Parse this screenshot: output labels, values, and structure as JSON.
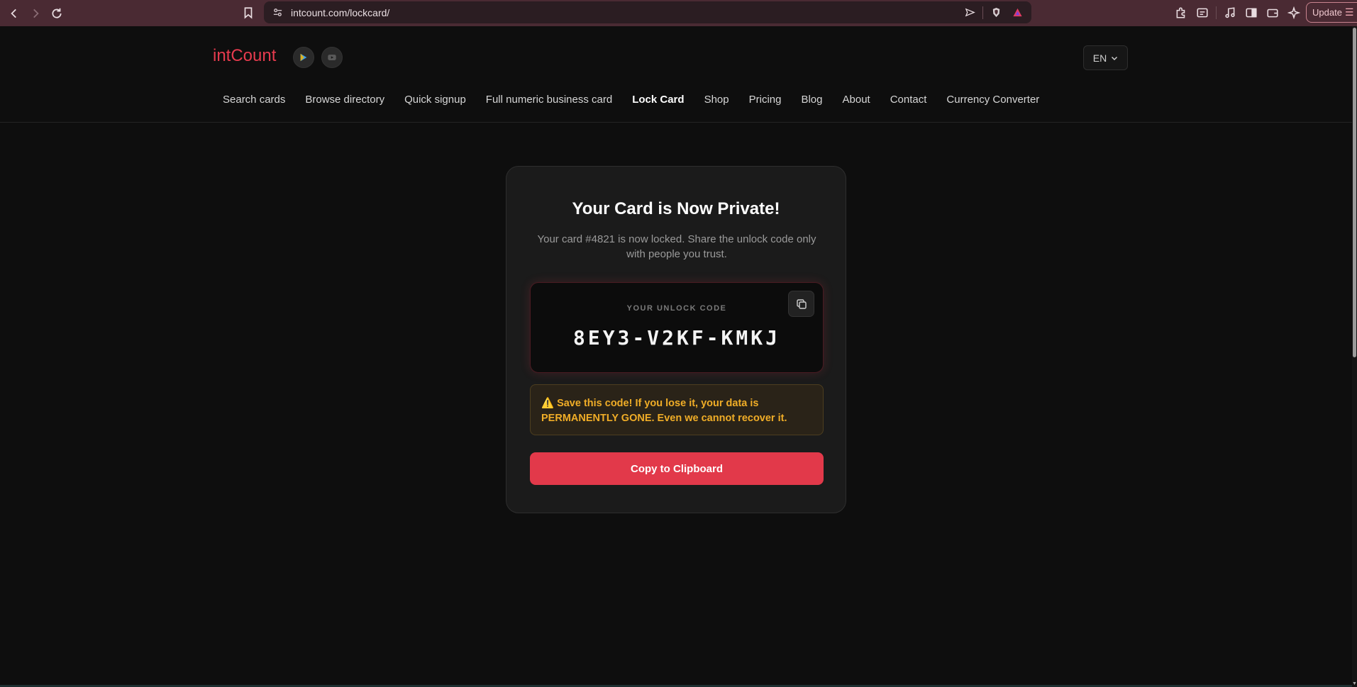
{
  "browser": {
    "url": "intcount.com/lockcard/",
    "update_label": "Update",
    "icons": [
      "back-icon",
      "forward-icon",
      "reload-icon",
      "bookmark-icon",
      "site-info-icon",
      "send-icon",
      "brave-shield-icon",
      "brave-rewards-icon",
      "extensions-icon",
      "screenshot-icon",
      "media-icon",
      "sidebar-icon",
      "wallet-icon",
      "leo-icon",
      "menu-icon"
    ]
  },
  "header": {
    "brand": "intCount",
    "language": "EN",
    "nav": [
      {
        "label": "Search cards"
      },
      {
        "label": "Browse directory"
      },
      {
        "label": "Quick signup"
      },
      {
        "label": "Full numeric business card"
      },
      {
        "label": "Lock Card",
        "active": true
      },
      {
        "label": "Shop"
      },
      {
        "label": "Pricing"
      },
      {
        "label": "Blog"
      },
      {
        "label": "About"
      },
      {
        "label": "Contact"
      },
      {
        "label": "Currency Converter"
      }
    ]
  },
  "card": {
    "title": "Your Card is Now Private!",
    "description": "Your card #4821 is now locked. Share the unlock code only with people you trust.",
    "code_label": "YOUR UNLOCK CODE",
    "code": "8EY3-V2KF-KMKJ",
    "warning_icon": "⚠️",
    "warning": "Save this code! If you lose it, your data is PERMANENTLY GONE. Even we cannot recover it.",
    "copy_button": "Copy to Clipboard"
  },
  "colors": {
    "brand": "#e63b4e",
    "button": "#e2394a",
    "warning_text": "#f0ad27",
    "background": "#0e0e0e",
    "card_bg": "#1b1b1b",
    "browser_bar": "#4a2a33"
  }
}
